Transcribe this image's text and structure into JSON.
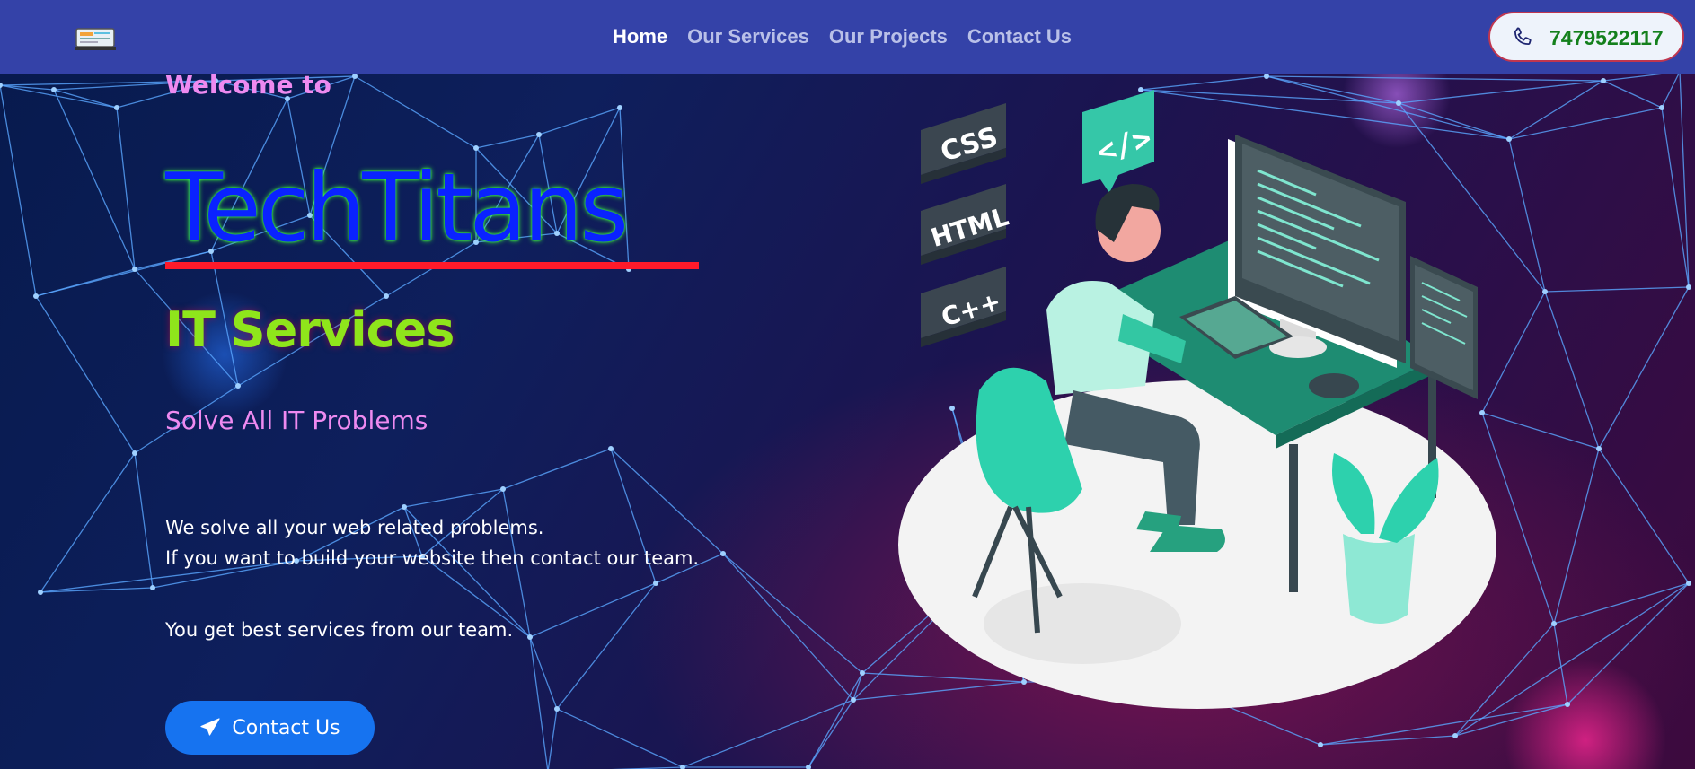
{
  "navbar": {
    "links": [
      {
        "label": "Home",
        "active": true
      },
      {
        "label": "Our Services",
        "active": false
      },
      {
        "label": "Our Projects",
        "active": false
      },
      {
        "label": "Contact Us",
        "active": false
      }
    ],
    "phone": "7479522117"
  },
  "hero": {
    "welcome": "Welcome to",
    "brand": "TechTitans",
    "tagline": "IT Services",
    "subtitle": "Solve All IT Problems",
    "desc_line1": "We solve all your web related problems.",
    "desc_line2": "If you want to build your website then contact our team.",
    "desc_line3": "You get best services from our team.",
    "cta_label": "Contact Us"
  },
  "illustration": {
    "tiles": [
      "CSS",
      "HTML",
      "C++"
    ],
    "code_bubble": "</>"
  },
  "colors": {
    "navbar": "#3442a8",
    "cta": "#1673f0",
    "brand_text": "#0a22ff",
    "brand_underline": "#ff1a2a",
    "tagline": "#8fe51b",
    "accent_pink": "#ee8af0",
    "phone_text": "#14801c"
  }
}
